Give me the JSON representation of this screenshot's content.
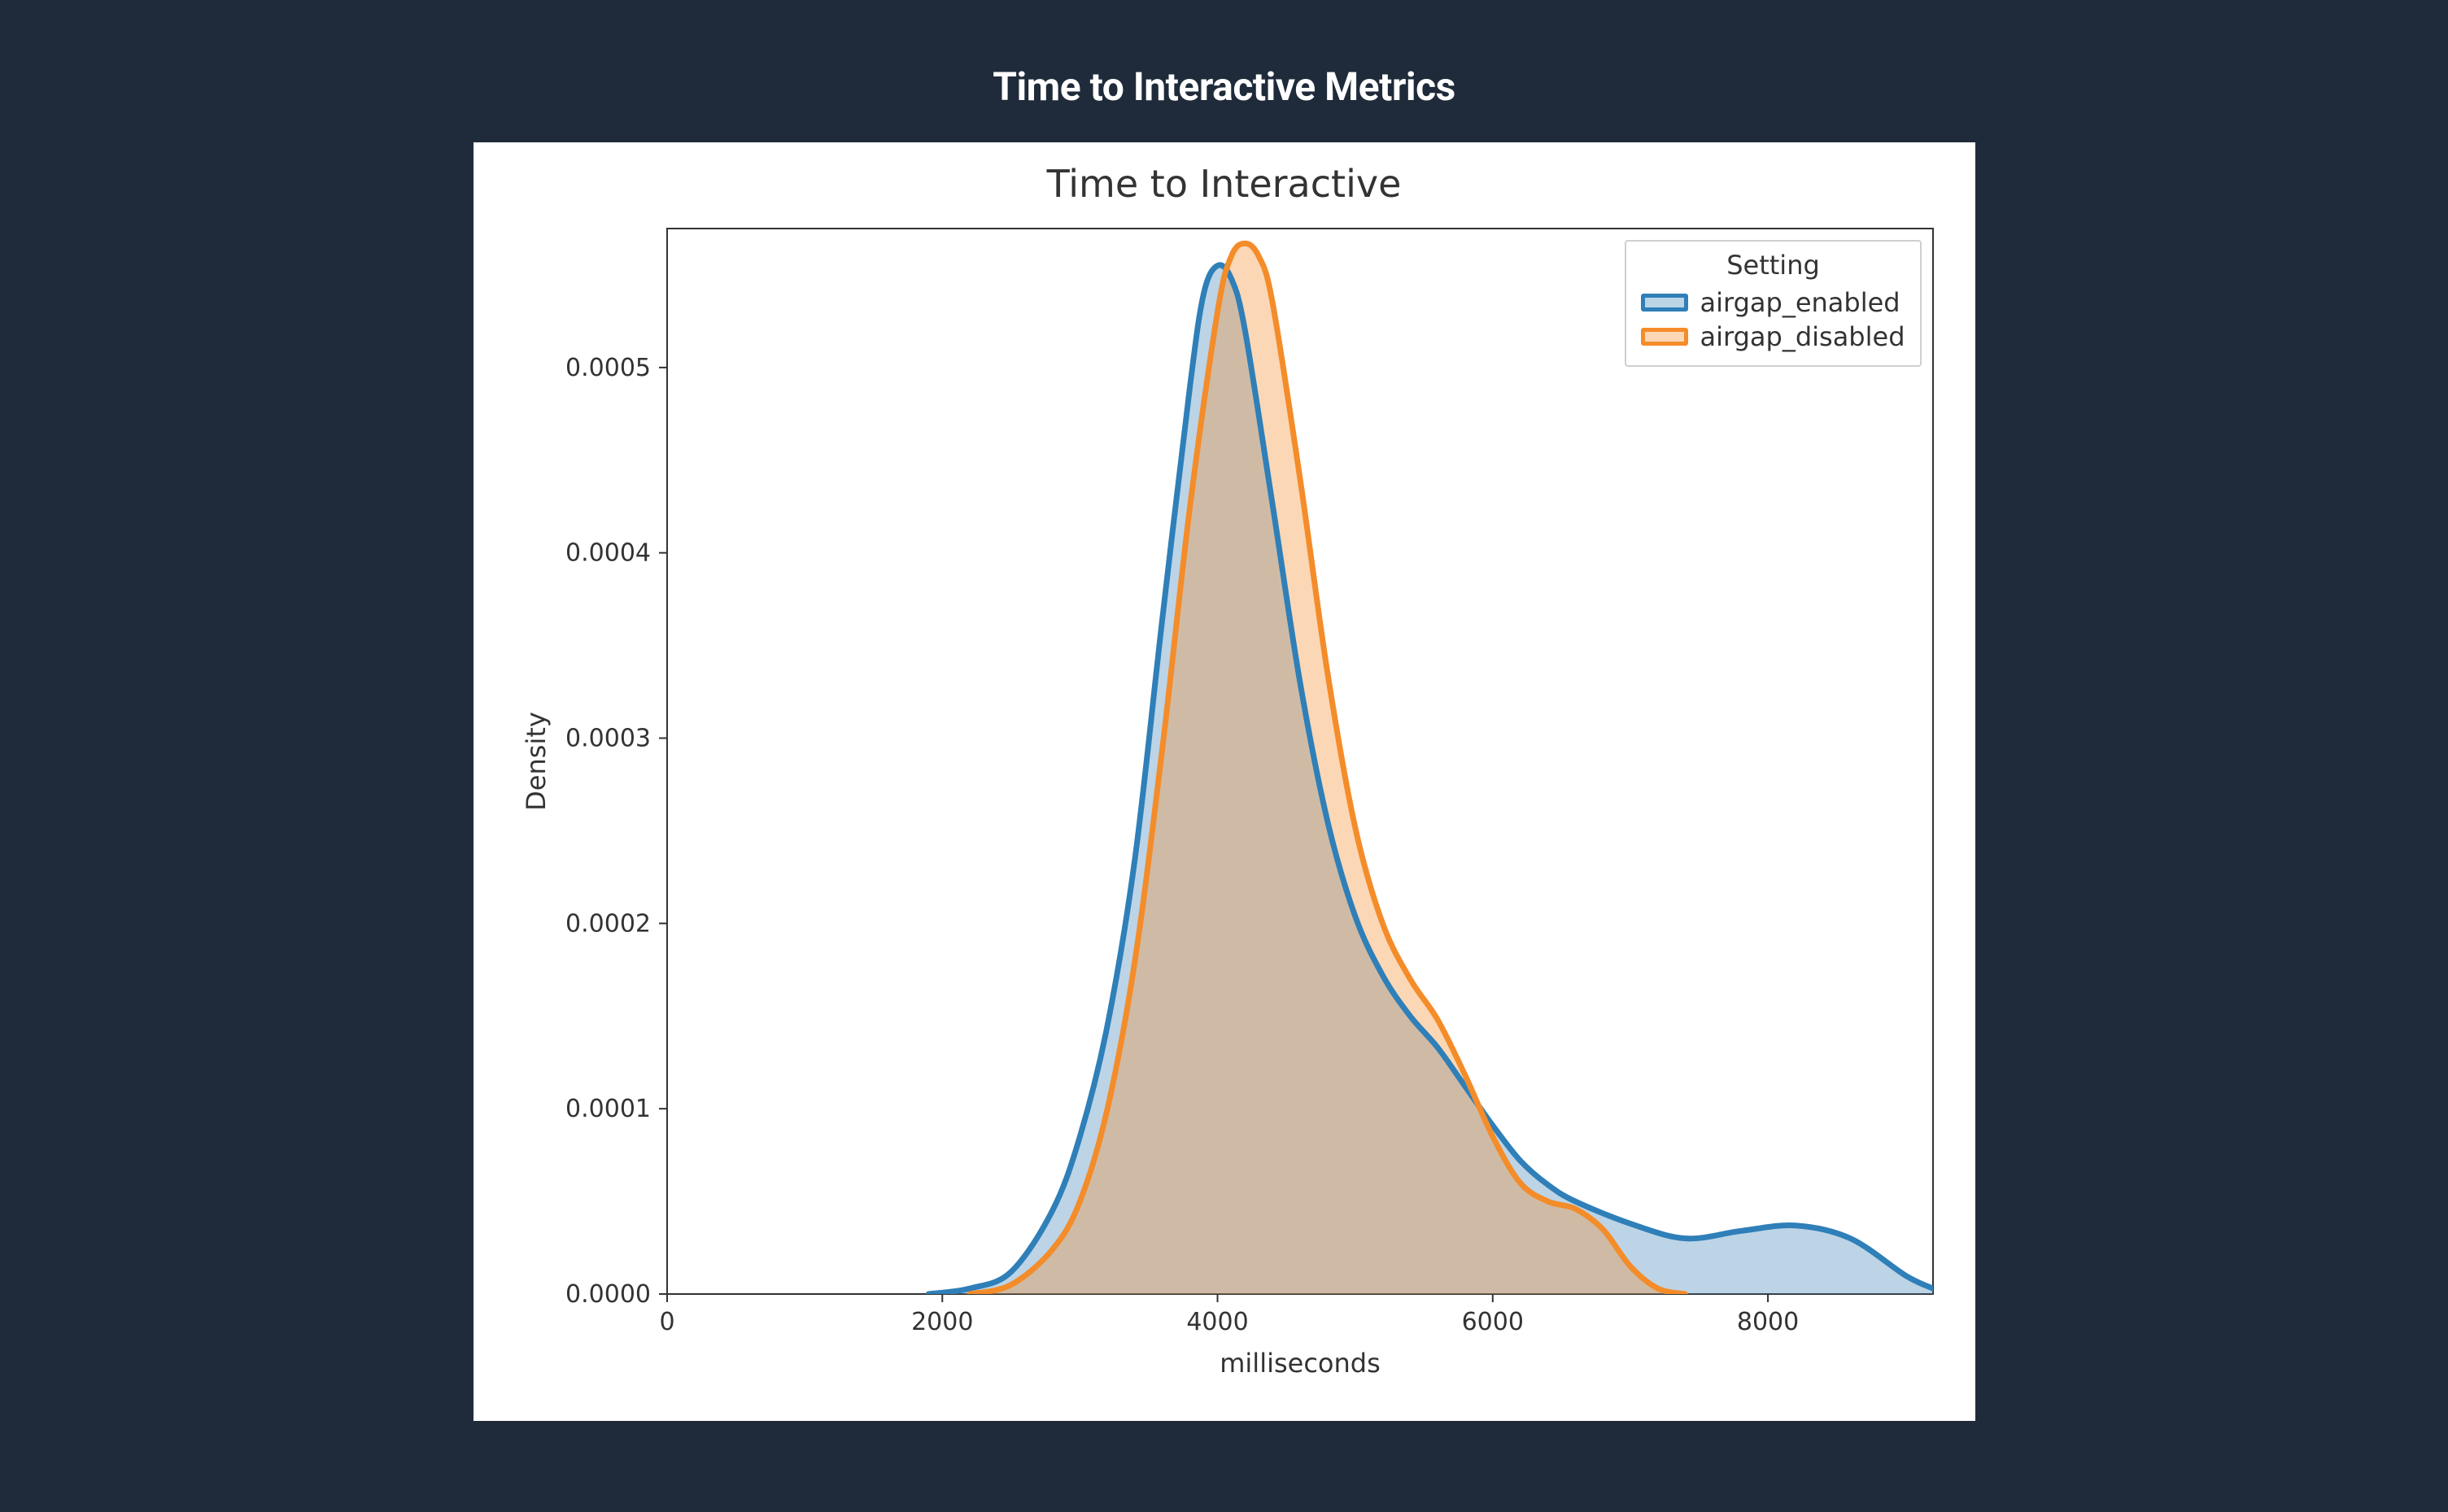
{
  "page": {
    "heading": "Time to Interactive Metrics"
  },
  "chart_data": {
    "type": "area",
    "title": "Time to Interactive",
    "xlabel": "milliseconds",
    "ylabel": "Density",
    "xlim": [
      0,
      9200
    ],
    "ylim": [
      0.0,
      0.000575
    ],
    "x_ticks": [
      0,
      2000,
      4000,
      6000,
      8000
    ],
    "y_ticks": [
      0.0,
      0.0001,
      0.0002,
      0.0003,
      0.0004,
      0.0005
    ],
    "y_tick_labels": [
      "0.0000",
      "0.0001",
      "0.0002",
      "0.0003",
      "0.0004",
      "0.0005"
    ],
    "legend": {
      "title": "Setting",
      "position": "upper-right",
      "entries": [
        "airgap_enabled",
        "airgap_disabled"
      ]
    },
    "colors": {
      "airgap_enabled": {
        "stroke": "#2f7fb8",
        "fill": "rgba(63,131,184,0.35)"
      },
      "airgap_disabled": {
        "stroke": "#f48c2a",
        "fill": "rgba(244,140,42,0.35)"
      }
    },
    "series": [
      {
        "name": "airgap_enabled",
        "x": [
          1900,
          2200,
          2500,
          2800,
          3000,
          3200,
          3400,
          3600,
          3800,
          3900,
          4000,
          4100,
          4200,
          4400,
          4600,
          4800,
          5000,
          5200,
          5400,
          5600,
          5800,
          6000,
          6200,
          6400,
          6600,
          7000,
          7400,
          7800,
          8200,
          8600,
          9000,
          9200
        ],
        "values": [
          0.0,
          3e-06,
          1.2e-05,
          4.5e-05,
          8.5e-05,
          0.000145,
          0.000235,
          0.000365,
          0.00049,
          0.00054,
          0.000555,
          0.000548,
          0.00052,
          0.000426,
          0.00033,
          0.000255,
          0.000204,
          0.000172,
          0.00015,
          0.000133,
          0.000112,
          9.1e-05,
          7.2e-05,
          5.9e-05,
          5e-05,
          3.8e-05,
          3e-05,
          3.4e-05,
          3.7e-05,
          3e-05,
          1e-05,
          3e-06
        ]
      },
      {
        "name": "airgap_disabled",
        "x": [
          2200,
          2500,
          2800,
          3000,
          3200,
          3400,
          3600,
          3800,
          4000,
          4100,
          4200,
          4300,
          4400,
          4600,
          4800,
          5000,
          5200,
          5400,
          5600,
          5800,
          6000,
          6200,
          6400,
          6600,
          6800,
          7000,
          7200,
          7400
        ],
        "values": [
          0.0,
          5e-06,
          2.4e-05,
          5e-05,
          0.0001,
          0.00018,
          0.000295,
          0.000425,
          0.00053,
          0.00056,
          0.000567,
          0.00056,
          0.000535,
          0.00044,
          0.000335,
          0.000252,
          0.0002,
          0.00017,
          0.000148,
          0.000118,
          8.5e-05,
          6e-05,
          5e-05,
          4.6e-05,
          3.5e-05,
          1.5e-05,
          3e-06,
          0.0
        ]
      }
    ]
  }
}
